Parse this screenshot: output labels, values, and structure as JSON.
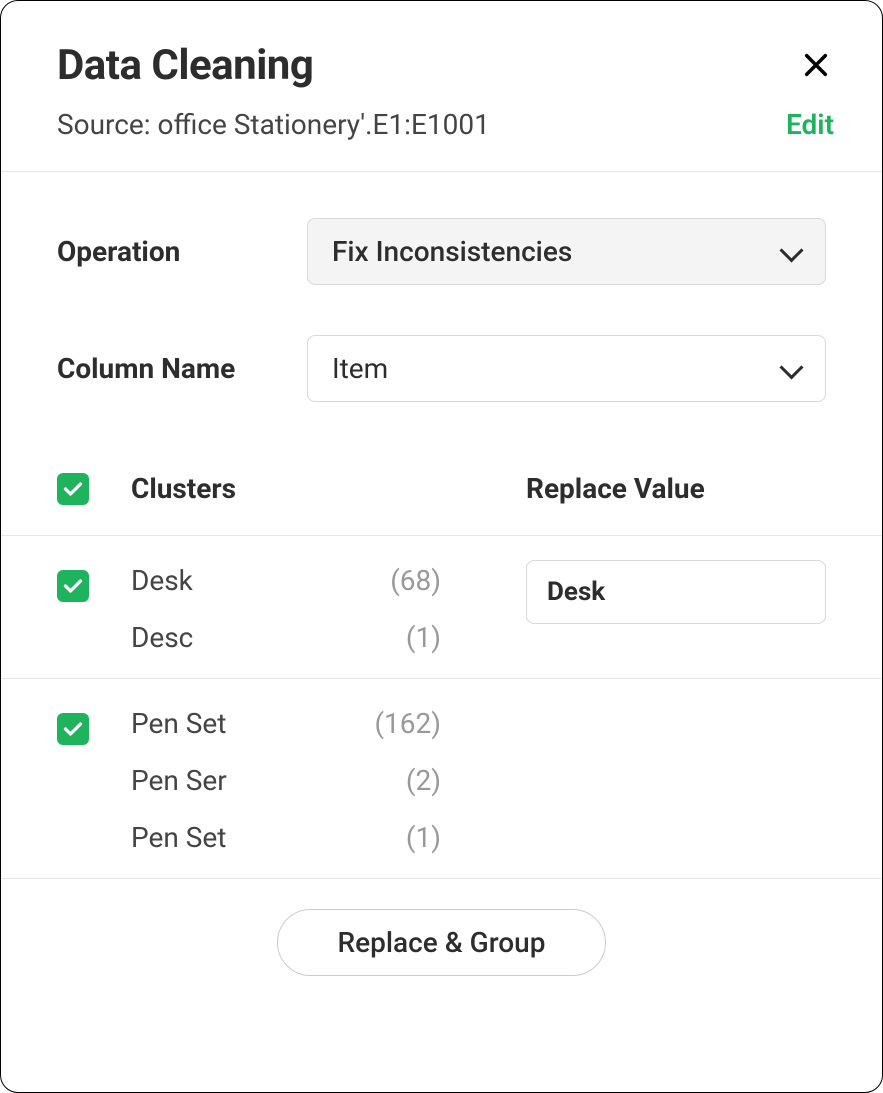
{
  "header": {
    "title": "Data Cleaning",
    "source_text": "Source: office Stationery'.E1:E1001",
    "edit_label": "Edit"
  },
  "form": {
    "operation_label": "Operation",
    "operation_value": "Fix Inconsistencies",
    "column_label": "Column Name",
    "column_value": "Item"
  },
  "table": {
    "header_clusters": "Clusters",
    "header_replace": "Replace Value",
    "clusters": [
      {
        "checked": true,
        "replace_value": "Desk",
        "items": [
          {
            "name": "Desk",
            "count": "(68)"
          },
          {
            "name": "Desc",
            "count": "(1)"
          }
        ]
      },
      {
        "checked": true,
        "replace_value": "",
        "items": [
          {
            "name": "Pen Set",
            "count": "(162)"
          },
          {
            "name": "Pen Ser",
            "count": "(2)"
          },
          {
            "name": "Pen Set",
            "count": "(1)"
          }
        ]
      }
    ]
  },
  "footer": {
    "button_label": "Replace & Group"
  }
}
